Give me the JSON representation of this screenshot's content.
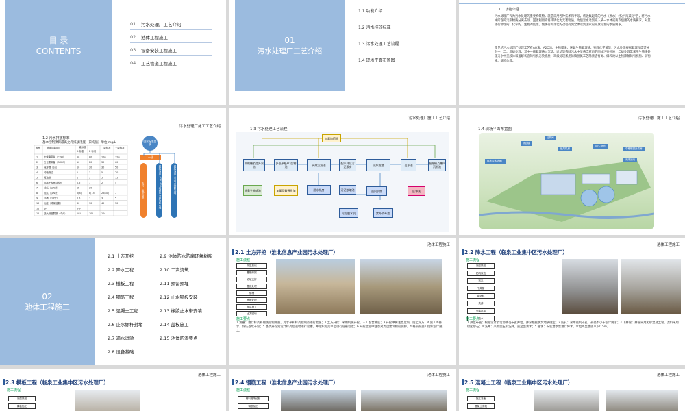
{
  "slides": {
    "toc": {
      "title_cn": "目 录",
      "title_en": "CONTENTS",
      "items": [
        {
          "num": "01",
          "label": "污水处理厂工艺介绍"
        },
        {
          "num": "02",
          "label": "池体工程施工"
        },
        {
          "num": "03",
          "label": "设备安装工程施工"
        },
        {
          "num": "04",
          "label": "工艺管道工程施工"
        }
      ]
    },
    "section01": {
      "num": "01",
      "title": "污水处理厂工艺介绍",
      "subs": [
        "1.1  功能介绍",
        "1.2  污水排放标准",
        "1.3  污水处理工艺流程",
        "1.4  现场平面布置图"
      ]
    },
    "func_intro": {
      "title": "1.1  功能介绍",
      "p1": "污水处理厂作为污水处理的重要构筑物，就是采用各种技术和手段，将收集起来的污水（原水）经过\"沟渠化\"后，将污水中所含的污染物质分离去除、回收利用或将其转化为无害物质，为使污水达到排入某一水体或再次使用的水质要求，对其进行物理的、化学的、生物的处理，使水得到净化的过程得到全体达到国家的排放标准的水质要求。",
      "p2": "常见的污水处理厂处理工艺有AO法、A2O法、生物膜法、厌氧生物处理法、物理化学法等，污水处理根据处理程度可分为一、二、三级处理，其中一级处理通过沉淀、过滤等去除污水中呈悬浮状态的固体污染物质；二级处理常采用生物法处理污水中呈胶体和溶解状态的有机污染物质，三级处理采用除磷脱氮工艺除去含有氮、磷和难以生物降解的有机物、矿物质、病原体等。"
    },
    "header_title": "污水处理厂施工工艺介绍",
    "standard": {
      "title": "1.2  污水排放标准",
      "subtitle": "基本控制项目最高允许排放浓度（日均值）单位 mg/L",
      "col_headers": [
        "序号",
        "基本控制项目",
        "一级标准",
        "二级标准",
        "三级标准"
      ],
      "sub_headers": [
        "A 标准",
        "B 标准"
      ],
      "rows": [
        [
          "1",
          "化学需氧量（COD）",
          "50",
          "60",
          "100",
          "120"
        ],
        [
          "2",
          "生化需氧量（BOD5）",
          "10",
          "20",
          "30",
          "60"
        ],
        [
          "3",
          "悬浮物（SS）",
          "10",
          "20",
          "30",
          "50"
        ],
        [
          "4",
          "动植物油",
          "1",
          "3",
          "5",
          "20"
        ],
        [
          "5",
          "石油类",
          "1",
          "3",
          "5",
          "15"
        ],
        [
          "6",
          "阴离子表面活性剂",
          "0.5",
          "1",
          "2",
          "5"
        ],
        [
          "7",
          "总氮（以N计）",
          "15",
          "20",
          "-",
          "-"
        ],
        [
          "8",
          "氨氮（以N计）",
          "5(8)",
          "8(15)",
          "25(30)",
          "-"
        ],
        [
          "9",
          "总磷（以P计）",
          "0.5",
          "1",
          "3",
          "5"
        ],
        [
          "10",
          "色度（稀释倍数）",
          "30",
          "30",
          "40",
          "50"
        ],
        [
          "11",
          "pH",
          "6-9",
          "",
          "",
          ""
        ],
        [
          "12",
          "粪大肠菌群数（个/L）",
          "10³",
          "10⁴",
          "10⁴",
          "-"
        ]
      ],
      "badge": "国家标准要求",
      "tag": "一级",
      "pill1": "执行一级A标准",
      "pill2": "二级标准排入GB3838地表水Ⅳ类功能水域",
      "pill3": "三级标准排入非重点控制流域"
    },
    "process": {
      "title": "1.3  污水处理工艺流程",
      "nodes": [
        "加氯加药间",
        "中格栅及提升泵房",
        "多段多级AO生物池",
        "高效沉淀池",
        "配水井及污泥泵房",
        "深床滤池",
        "出水池",
        "细格栅及曝气沉砂池",
        "除臭生物滤池",
        "脱水机房",
        "污泥浓缩池",
        "反冲洗",
        "污泥脱水机",
        "加氯及碳源投加",
        "鼓风机房",
        "紫外消毒池"
      ]
    },
    "siteplan": {
      "title": "1.4  现场平面布置图",
      "labels": [
        "现状污水处理厂",
        "综合楼",
        "加药间",
        "鼓风机房",
        "AO生物池",
        "中格栅提升泵房",
        "深床滤池"
      ]
    },
    "section02": {
      "num": "02",
      "title": "池体工程施工",
      "col1": [
        "2.1  土方开挖",
        "2.2  降水工程",
        "2.3  模板工程",
        "2.4  钢筋工程",
        "2.5  混凝土工程",
        "2.6  止水螺杆封堵",
        "2.7  满水试验",
        "2.8  设备基础"
      ],
      "col2": [
        "2.9  池体防水防腐环氧树脂",
        "2.10  二次浇筑",
        "2.11  预留预埋",
        "2.12  止水钢板安装",
        "2.13  橡胶止水带安装",
        "2.14  盖板施工",
        "2.15  池体防渗要点"
      ]
    },
    "pool_header": "池体工程施工",
    "s21": {
      "title": "2.1  土方开挖（淮北信息产业园污水处理厂）",
      "label": "施工流程",
      "label2": "施工要点",
      "steps": [
        "测量放线",
        "基槽开挖",
        "边坡支护",
        "基底处理",
        "验槽",
        "地基处理",
        "垫层施工",
        "土方回填"
      ],
      "text": "1.测量：进行标高和轴线控制测量，对水平和标高控制点进行复核；2.土方开挖：采用机械开挖，人工配合清底；3.开挖中要注意放坡，防止塌方；4.施工降排水，保证基坑干燥；5.基坑开挖到设计标高后及时进行验槽，并组织相关单位进行隐蔽验收；6.开挖过程中注意对周边建筑物的保护，严格按照施工组织设计施工。"
    },
    "s22": {
      "title": "2.2  降水工程（临泉工业集中区污水处理厂）",
      "label": "施工流程",
      "label2": "施工要点",
      "steps": [
        "测量放线",
        "钻机就位",
        "钻孔",
        "下井管",
        "填滤料",
        "洗井",
        "安装水泵",
        "抽水"
      ],
      "text": "1.井位布置：根据设计及现场情况布置井位，井深根据水文地质确定；2.成孔：采用钻机成孔，孔径不小于设计要求；3.下井管：井管采用无砂混凝土管，滤料采用级配砂石；4.洗井：采用空压机洗井，直至出清水；5.抽水：安装潜水泵进行降水，水位降至基底以下0.5m。"
    },
    "s23": {
      "title": "2.3  模板工程（临泉工业集中区污水处理厂）",
      "label": "施工流程",
      "steps": [
        "测量放线",
        "模板加工"
      ]
    },
    "s24": {
      "title": "2.4  钢筋工程（淮北信息产业园污水处理厂）",
      "label": "施工流程",
      "steps": [
        "材料进场检验",
        "钢筋加工"
      ]
    },
    "s25": {
      "title": "2.5  混凝土工程（临泉工业集中区污水处理厂）",
      "label": "施工流程",
      "steps": [
        "施工准备",
        "混凝土浇筑"
      ]
    }
  }
}
